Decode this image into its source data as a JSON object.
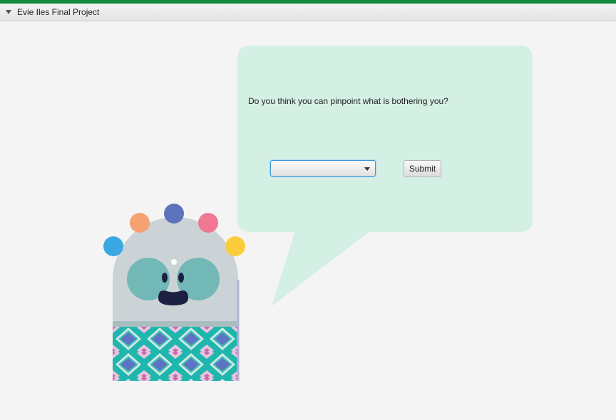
{
  "window": {
    "title": "Evie Iles Final Project"
  },
  "dialog": {
    "question": "Do you think you can pinpoint what is bothering you?",
    "answer_select": {
      "selected": ""
    },
    "submit_label": "Submit"
  },
  "mascot": {
    "icon": "monster-mascot-icon"
  },
  "colors": {
    "accent_bar": "#138a3e",
    "bubble": "#d4efe3",
    "face": "#72b8b6",
    "body": "#ccd3d6"
  }
}
